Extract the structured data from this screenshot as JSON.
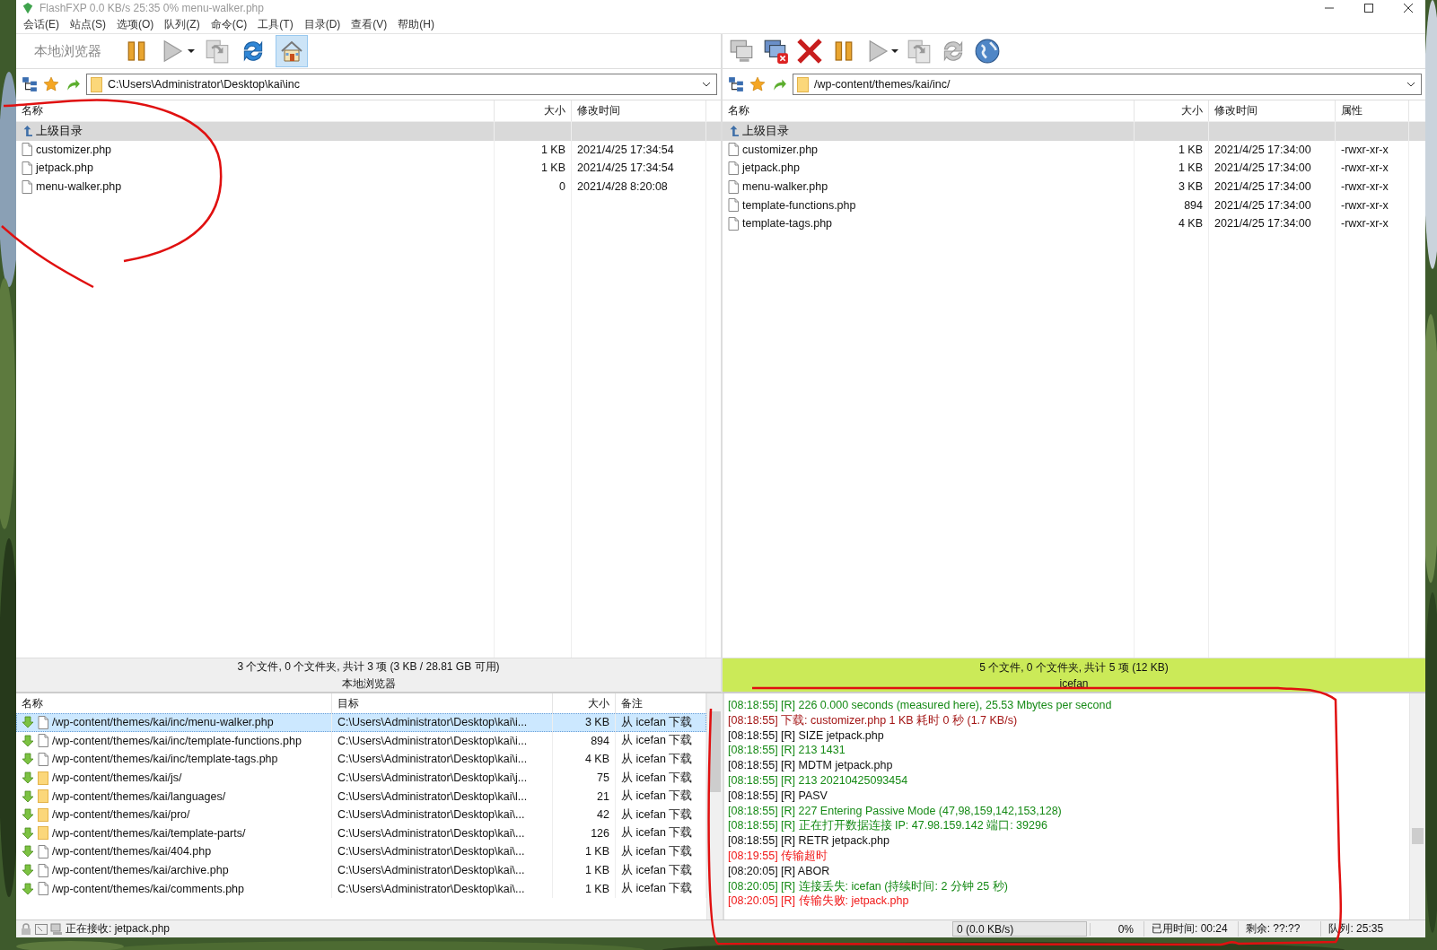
{
  "window": {
    "title": "FlashFXP 0.0 KB/s 25:35 0% menu-walker.php"
  },
  "menu": [
    "会话(E)",
    "站点(S)",
    "选项(O)",
    "队列(Z)",
    "命令(C)",
    "工具(T)",
    "目录(D)",
    "查看(V)",
    "帮助(H)"
  ],
  "local": {
    "toolbar_label": "本地浏览器",
    "home_pressed": true,
    "path": "C:\\Users\\Administrator\\Desktop\\kai\\inc",
    "columns": [
      "名称",
      "大小",
      "修改时间"
    ],
    "parent": "上级目录",
    "files": [
      {
        "name": "customizer.php",
        "size": "1 KB",
        "modified": "2021/4/25 17:34:54"
      },
      {
        "name": "jetpack.php",
        "size": "1 KB",
        "modified": "2021/4/25 17:34:54"
      },
      {
        "name": "menu-walker.php",
        "size": "0",
        "modified": "2021/4/28 8:20:08"
      }
    ],
    "status": "3 个文件, 0 个文件夹, 共计 3 项 (3 KB / 28.81 GB 可用)",
    "title": "本地浏览器",
    "active": false
  },
  "remote": {
    "path": "/wp-content/themes/kai/inc/",
    "columns": [
      "名称",
      "大小",
      "修改时间",
      "属性"
    ],
    "parent": "上级目录",
    "files": [
      {
        "name": "customizer.php",
        "size": "1 KB",
        "modified": "2021/4/25 17:34:00",
        "attributes": "-rwxr-xr-x"
      },
      {
        "name": "jetpack.php",
        "size": "1 KB",
        "modified": "2021/4/25 17:34:00",
        "attributes": "-rwxr-xr-x"
      },
      {
        "name": "menu-walker.php",
        "size": "3 KB",
        "modified": "2021/4/25 17:34:00",
        "attributes": "-rwxr-xr-x"
      },
      {
        "name": "template-functions.php",
        "size": "894",
        "modified": "2021/4/25 17:34:00",
        "attributes": "-rwxr-xr-x"
      },
      {
        "name": "template-tags.php",
        "size": "4 KB",
        "modified": "2021/4/25 17:34:00",
        "attributes": "-rwxr-xr-x"
      }
    ],
    "status": "5 个文件, 0 个文件夹, 共计 5 项 (12 KB)",
    "title": "icefan",
    "active": true
  },
  "queue": {
    "columns": [
      "名称",
      "目标",
      "大小",
      "备注"
    ],
    "items": [
      {
        "kind": "file",
        "name": "/wp-content/themes/kai/inc/menu-walker.php",
        "target": "C:\\Users\\Administrator\\Desktop\\kai\\i...",
        "size": "3 KB",
        "note": "从 icefan 下载",
        "selected": true
      },
      {
        "kind": "file",
        "name": "/wp-content/themes/kai/inc/template-functions.php",
        "target": "C:\\Users\\Administrator\\Desktop\\kai\\i...",
        "size": "894",
        "note": "从 icefan 下载",
        "selected": false
      },
      {
        "kind": "file",
        "name": "/wp-content/themes/kai/inc/template-tags.php",
        "target": "C:\\Users\\Administrator\\Desktop\\kai\\i...",
        "size": "4 KB",
        "note": "从 icefan 下载",
        "selected": false
      },
      {
        "kind": "folder",
        "name": "/wp-content/themes/kai/js/",
        "target": "C:\\Users\\Administrator\\Desktop\\kai\\j...",
        "size": "75",
        "note": "从 icefan 下载",
        "selected": false
      },
      {
        "kind": "folder",
        "name": "/wp-content/themes/kai/languages/",
        "target": "C:\\Users\\Administrator\\Desktop\\kai\\l...",
        "size": "21",
        "note": "从 icefan 下载",
        "selected": false
      },
      {
        "kind": "folder",
        "name": "/wp-content/themes/kai/pro/",
        "target": "C:\\Users\\Administrator\\Desktop\\kai\\...",
        "size": "42",
        "note": "从 icefan 下载",
        "selected": false
      },
      {
        "kind": "folder",
        "name": "/wp-content/themes/kai/template-parts/",
        "target": "C:\\Users\\Administrator\\Desktop\\kai\\...",
        "size": "126",
        "note": "从 icefan 下载",
        "selected": false
      },
      {
        "kind": "file",
        "name": "/wp-content/themes/kai/404.php",
        "target": "C:\\Users\\Administrator\\Desktop\\kai\\...",
        "size": "1 KB",
        "note": "从 icefan 下载",
        "selected": false
      },
      {
        "kind": "file",
        "name": "/wp-content/themes/kai/archive.php",
        "target": "C:\\Users\\Administrator\\Desktop\\kai\\...",
        "size": "1 KB",
        "note": "从 icefan 下载",
        "selected": false
      },
      {
        "kind": "file",
        "name": "/wp-content/themes/kai/comments.php",
        "target": "C:\\Users\\Administrator\\Desktop\\kai\\...",
        "size": "1 KB",
        "note": "从 icefan 下载",
        "selected": false
      }
    ]
  },
  "log": [
    {
      "kind": "reply",
      "text": "[08:18:55] [R] 226 0.000 seconds (measured here), 25.53 Mbytes per second"
    },
    {
      "kind": "info",
      "text": "[08:18:55] 下载: customizer.php 1 KB 耗时 0 秒 (1.7 KB/s)"
    },
    {
      "kind": "command",
      "text": "[08:18:55] [R] SIZE jetpack.php"
    },
    {
      "kind": "reply",
      "text": "[08:18:55] [R] 213 1431"
    },
    {
      "kind": "command",
      "text": "[08:18:55] [R] MDTM jetpack.php"
    },
    {
      "kind": "reply",
      "text": "[08:18:55] [R] 213 20210425093454"
    },
    {
      "kind": "command",
      "text": "[08:18:55] [R] PASV"
    },
    {
      "kind": "reply",
      "text": "[08:18:55] [R] 227 Entering Passive Mode (47,98,159,142,153,128)"
    },
    {
      "kind": "reply",
      "text": "[08:18:55] [R] 正在打开数据连接 IP: 47.98.159.142 端口: 39296"
    },
    {
      "kind": "command",
      "text": "[08:18:55] [R] RETR jetpack.php"
    },
    {
      "kind": "error",
      "text": "[08:19:55] 传输超时"
    },
    {
      "kind": "command",
      "text": "[08:20:05] [R] ABOR"
    },
    {
      "kind": "reply",
      "text": "[08:20:05] [R] 连接丢失: icefan (持续时间: 2 分钟 25 秒)"
    },
    {
      "kind": "error",
      "text": "[08:20:05] [R] 传输失败: jetpack.php"
    }
  ],
  "status_bar": {
    "message": "正在接收: jetpack.php",
    "progress": {
      "text": "0 (0.0 KB/s)",
      "level": 0
    },
    "percent": "0%",
    "elapsed": "已用时间: 00:24",
    "remaining": "剩余: ??:??",
    "queue": "队列: 25:35"
  }
}
